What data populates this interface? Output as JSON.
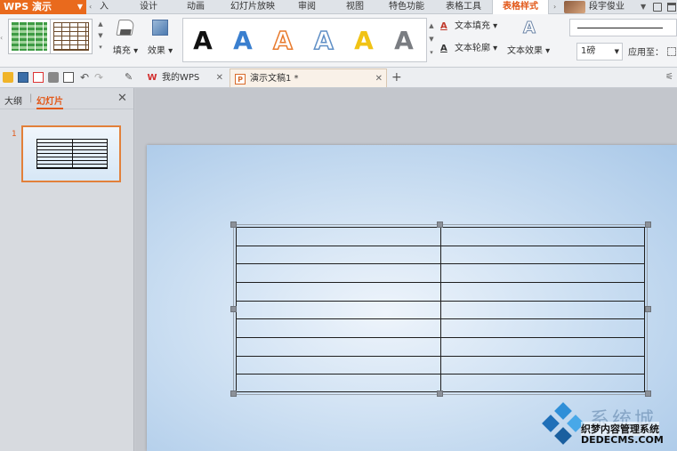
{
  "colors": {
    "accent": "#e96a1d",
    "active_tab": "#e2591a",
    "slide_bg": "#cfe1f3"
  },
  "app": {
    "title": "WPS 演示"
  },
  "menu": {
    "back_arrow": "‹",
    "cut_item": "入",
    "tabs": [
      {
        "label": "设计"
      },
      {
        "label": "动画"
      },
      {
        "label": "幻灯片放映"
      },
      {
        "label": "审阅"
      },
      {
        "label": "视图"
      },
      {
        "label": "特色功能"
      },
      {
        "label": "表格工具"
      },
      {
        "label": "表格样式"
      }
    ],
    "forward_arrow": "›",
    "user_name": "段宇俊业"
  },
  "ribbon": {
    "fill_label": "填充",
    "effect_label": "效果",
    "wordart_letter": "A",
    "text_fill_label": "文本填充",
    "text_outline_label": "文本轮廓",
    "text_effect_label": "文本效果",
    "line_weight_value": "1磅",
    "apply_to_label": "应用至："
  },
  "toolbar": {
    "tabs": [
      {
        "label": "我的WPS"
      },
      {
        "label": "演示文稿1 *"
      }
    ],
    "wps_icon_glyph": "W",
    "doc_icon_glyph": "P",
    "new_tab": "+"
  },
  "panel": {
    "tab_outline": "大纲",
    "tab_separator": "|",
    "tab_slides": "幻灯片",
    "slide_number": "1"
  },
  "slide": {
    "table": {
      "rows": 9,
      "columns": 2
    }
  },
  "watermark": {
    "brand": "系统城",
    "cms_line": "织梦内容管理系统",
    "url": "DEDECMS.COM"
  }
}
